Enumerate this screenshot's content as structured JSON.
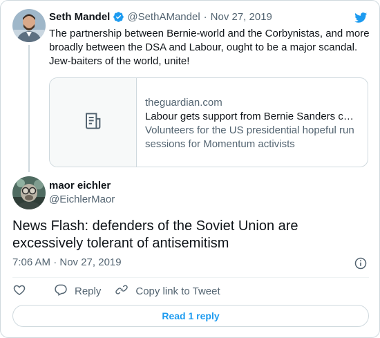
{
  "parent_tweet": {
    "author_name": "Seth Mandel",
    "author_handle": "@SethAMandel",
    "separator": "·",
    "date": "Nov 27, 2019",
    "text": "The partnership between Bernie-world and the Corbynistas, and more broadly between the DSA and Labour, ought to be a major scandal. Jew-baiters of the world, unite!",
    "link_card": {
      "domain": "theguardian.com",
      "title": "Labour gets support from Bernie Sanders c…",
      "description": "Volunteers for the US presidential hopeful run sessions for Momentum activists"
    }
  },
  "main_tweet": {
    "author_name": "maor eichler",
    "author_handle": "@EichlerMaor",
    "text": "News Flash: defenders of the Soviet Union are excessively tolerant of antisemitism",
    "timestamp": "7:06 AM · Nov 27, 2019"
  },
  "actions": {
    "reply_label": "Reply",
    "copy_link_label": "Copy link to Tweet"
  },
  "read_replies_label": "Read 1 reply",
  "colors": {
    "accent": "#1d9bf0",
    "text_primary": "#0f1419",
    "text_secondary": "#536471",
    "border": "#cfd9de"
  },
  "icons": {
    "brand": "twitter-bird-icon",
    "verified": "verified-badge-icon",
    "link_thumb": "document-icon",
    "info": "info-icon",
    "like": "heart-icon",
    "reply": "reply-bubble-icon",
    "copy_link": "link-icon"
  }
}
